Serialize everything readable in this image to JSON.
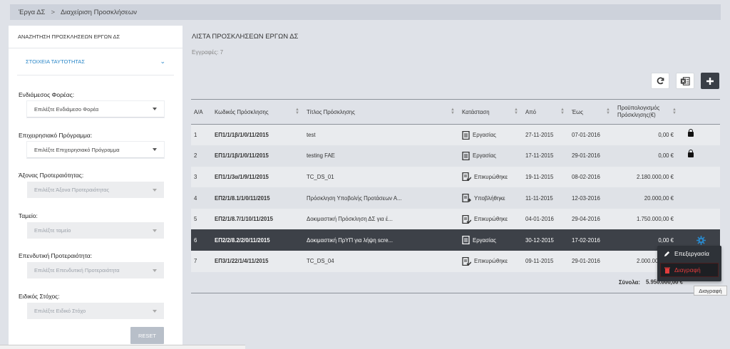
{
  "breadcrumb": {
    "root": "Έργα ΔΣ",
    "separator": ">",
    "current": "Διαχείριση Προσκλήσεων"
  },
  "sidebar": {
    "title": "ΑΝΑΖΗΤΗΣΗ ΠΡΟΣΚΛΗΣΕΩΝ ΕΡΓΩΝ ΔΣ",
    "section": "ΣΤΟΙΧΕΙΑ ΤΑΥΤΟΤΗΤΑΣ",
    "fields": [
      {
        "label": "Ενδιάμεσος Φορέας:",
        "placeholder": "Επιλέξτε Ενδιάμεσο Φορέα",
        "disabled": false
      },
      {
        "label": "Επιχειρησιακό Πρόγραμμα:",
        "placeholder": "Επιλέξτε Επιχειρησιακό Πρόγραμμα",
        "disabled": false
      },
      {
        "label": "Άξονας Προτεραιότητας:",
        "placeholder": "Επιλέξτε Άξονα Προτεραιότητας",
        "disabled": true
      },
      {
        "label": "Ταμείο:",
        "placeholder": "Επιλέξτε ταμείο",
        "disabled": true
      },
      {
        "label": "Επενδυτική Προτεραιότητα:",
        "placeholder": "Επιλέξτε Επενδυτική Προτεραιότητα",
        "disabled": true
      },
      {
        "label": "Ειδικός Στόχος:",
        "placeholder": "Επιλέξτε Ειδικό Στόχο",
        "disabled": true
      }
    ],
    "reset_label": "RESET"
  },
  "main": {
    "title": "ΛΙΣΤΑ ΠΡΟΣΚΛΗΣΕΩΝ ΕΡΓΩΝ ΔΣ",
    "records": "Εγγραφές: 7",
    "toolbar": {
      "refresh_icon": "refresh-icon",
      "excel_icon": "excel-icon",
      "add_icon": "plus-icon"
    }
  },
  "table": {
    "headers": [
      "Α/Α",
      "Κωδικός Πρόσκλησης",
      "Τίτλος Πρόσκλησης",
      "Κατάσταση",
      "Από",
      "Έως",
      "Προϋπολογισμός Πρόσκλησης(€)"
    ],
    "rows": [
      {
        "aa": "1",
        "code": "ΕΠ1/1/1β/1/0/11/2015",
        "title": "test",
        "status": "Εργασίας",
        "status_icon": "document-icon",
        "from": "27-11-2015",
        "to": "07-01-2016",
        "budget": "0,00 €",
        "action": "lock-icon"
      },
      {
        "aa": "2",
        "code": "ΕΠ1/1/1β/1/0/11/2015",
        "title": "testing FAE",
        "status": "Εργασίας",
        "status_icon": "document-icon",
        "from": "17-11-2015",
        "to": "29-01-2016",
        "budget": "0,00 €",
        "action": "lock-icon"
      },
      {
        "aa": "3",
        "code": "ΕΠ1/1/3α/1/9/11/2015",
        "title": "TC_DS_01",
        "status": "Επικυρώθηκε",
        "status_icon": "document-approved-icon",
        "from": "19-11-2015",
        "to": "08-02-2016",
        "budget": "2.180.000,00 €",
        "action": ""
      },
      {
        "aa": "4",
        "code": "ΕΠ2/1/8.1/1/0/11/2015",
        "title": "Πρόσκληση Υποβολής Προτάσεων Α...",
        "status": "Υποβλήθηκε",
        "status_icon": "document-submitted-icon",
        "from": "11-11-2015",
        "to": "12-03-2016",
        "budget": "20.000,00 €",
        "action": ""
      },
      {
        "aa": "5",
        "code": "ΕΠ2/1/8.7/1/10/11/2015",
        "title": "Δοκιμαστική Πρόσκληση ΔΣ για έ...",
        "status": "Επικυρώθηκε",
        "status_icon": "document-approved-icon",
        "from": "04-01-2016",
        "to": "29-04-2016",
        "budget": "1.750.000,00 €",
        "action": ""
      },
      {
        "aa": "6",
        "code": "ΕΠ2/2/8.2/2/0/11/2015",
        "title": "Δοκιμαστική ΠρΥΠ για λήψη scre...",
        "status": "Εργασίας",
        "status_icon": "document-icon",
        "from": "30-12-2015",
        "to": "17-02-2016",
        "budget": "0,00 €",
        "action": "gear-icon"
      },
      {
        "aa": "7",
        "code": "ΕΠ3/1/22/1/4/11/2015",
        "title": "TC_DS_04",
        "status": "Επικυρώθηκε",
        "status_icon": "document-approved-icon",
        "from": "09-11-2015",
        "to": "29-01-2016",
        "budget": "2.000.000,00 €",
        "action": ""
      }
    ],
    "totals_label": "Σύνολα:",
    "totals_value": "5.950.000,00 €"
  },
  "context_menu": {
    "edit_label": "Επεξεργασία",
    "delete_label": "Διαγραφή"
  },
  "tooltip": "Διαγραφή",
  "statusbar": "",
  "colors": {
    "accent": "#2a87c8",
    "selected_row": "#3d4148",
    "gear": "#2a87c8",
    "delete": "#e23c3c"
  }
}
